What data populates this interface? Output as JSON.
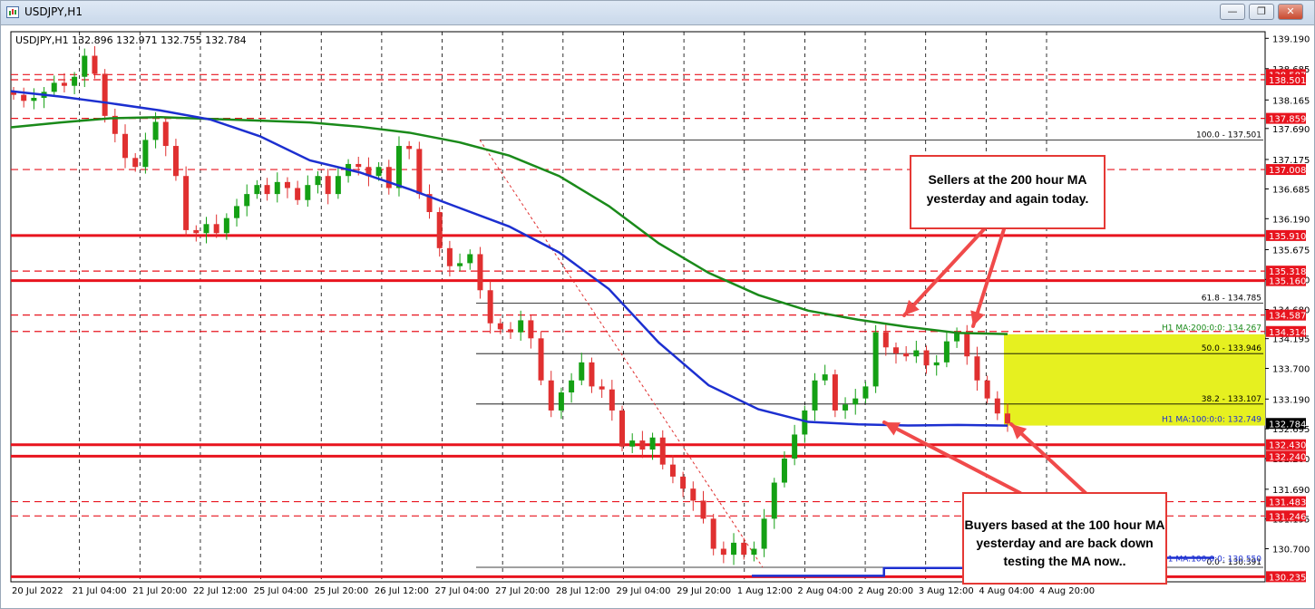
{
  "window": {
    "title": "USDJPY,H1",
    "buttons": [
      "minimize",
      "restore",
      "close"
    ]
  },
  "chart_data": {
    "type": "candlestick",
    "symbol": "USDJPY",
    "timeframe": "H1",
    "info_line": "USDJPY,H1  132.896 132.971 132.755 132.784",
    "current_price": "132.784",
    "ylim": [
      130.15,
      139.3
    ],
    "y_ticks": [
      "139.190",
      "138.685",
      "138.165",
      "137.690",
      "137.175",
      "136.685",
      "136.190",
      "135.675",
      "135.180",
      "134.680",
      "134.195",
      "133.700",
      "133.190",
      "132.695",
      "132.200",
      "131.690",
      "131.195",
      "130.700"
    ],
    "x_ticks": [
      "20 Jul 2022",
      "21 Jul 04:00",
      "21 Jul 20:00",
      "22 Jul 12:00",
      "25 Jul 04:00",
      "25 Jul 20:00",
      "26 Jul 12:00",
      "27 Jul 04:00",
      "27 Jul 20:00",
      "28 Jul 12:00",
      "29 Jul 04:00",
      "29 Jul 20:00",
      "1 Aug 12:00",
      "2 Aug 04:00",
      "2 Aug 20:00",
      "3 Aug 12:00",
      "4 Aug 04:00",
      "4 Aug 20:00"
    ],
    "close_series_approx": [
      138.25,
      138.15,
      138.2,
      138.3,
      138.45,
      138.4,
      138.55,
      138.9,
      138.6,
      137.9,
      137.6,
      137.2,
      137.05,
      137.5,
      137.8,
      137.4,
      136.9,
      136.0,
      135.95,
      136.1,
      135.95,
      136.2,
      136.4,
      136.6,
      136.75,
      136.6,
      136.8,
      136.7,
      136.5,
      136.75,
      136.9,
      136.6,
      136.9,
      137.1,
      137.05,
      136.9,
      137.05,
      136.7,
      137.4,
      137.35,
      136.6,
      136.3,
      135.7,
      135.4,
      135.45,
      135.6,
      135.0,
      134.45,
      134.35,
      134.3,
      134.5,
      134.2,
      133.5,
      133.0,
      133.3,
      133.5,
      133.8,
      133.4,
      133.35,
      133.0,
      132.4,
      132.5,
      132.35,
      132.55,
      132.1,
      131.9,
      131.7,
      131.5,
      131.2,
      130.7,
      130.6,
      130.8,
      130.6,
      130.7,
      131.2,
      131.8,
      132.2,
      132.6,
      133.0,
      133.5,
      133.6,
      133.0,
      133.1,
      133.2,
      133.4,
      134.3,
      134.05,
      133.95,
      133.9,
      134.0,
      133.75,
      133.8,
      134.15,
      134.3,
      133.9,
      133.5,
      133.2,
      132.95,
      132.784
    ],
    "series": [
      {
        "name": "H1 MA:200:0:0",
        "value_label": "134.267",
        "color": "#1a8a1a",
        "values": [
          137.71,
          137.79,
          137.86,
          137.88,
          137.85,
          137.82,
          137.79,
          137.72,
          137.62,
          137.46,
          137.24,
          136.9,
          136.4,
          135.78,
          135.29,
          134.92,
          134.66,
          134.51,
          134.39,
          134.29,
          134.27
        ]
      },
      {
        "name": "H1 MA:100:0:0",
        "value_label": "132.749",
        "color": "#1c2fd0",
        "values": [
          138.31,
          138.22,
          138.11,
          137.99,
          137.84,
          137.56,
          137.16,
          136.96,
          136.68,
          136.37,
          136.06,
          135.63,
          135.02,
          134.13,
          133.42,
          133.02,
          132.81,
          132.77,
          132.75,
          132.76,
          132.749
        ]
      },
      {
        "name": "D1 MA:100:0:0",
        "value_label": "130.550",
        "color": "#1c2fd0",
        "values": [
          130.25,
          130.25,
          130.38,
          130.38,
          130.55,
          130.55,
          130.55
        ]
      }
    ],
    "horizontal_levels": [
      {
        "label": "138.587",
        "value": 138.587,
        "style": "dashed"
      },
      {
        "label": "138.501",
        "value": 138.501,
        "style": "dashed"
      },
      {
        "label": "137.859",
        "value": 137.859,
        "style": "dashed"
      },
      {
        "label": "137.008",
        "value": 137.008,
        "style": "dashed"
      },
      {
        "label": "135.910",
        "value": 135.91,
        "style": "solid"
      },
      {
        "label": "135.318",
        "value": 135.318,
        "style": "dashed"
      },
      {
        "label": "135.160",
        "value": 135.16,
        "style": "solid"
      },
      {
        "label": "134.587",
        "value": 134.587,
        "style": "dashed"
      },
      {
        "label": "134.314",
        "value": 134.314,
        "style": "dashed"
      },
      {
        "label": "132.430",
        "value": 132.43,
        "style": "solid"
      },
      {
        "label": "132.240",
        "value": 132.24,
        "style": "solid"
      },
      {
        "label": "131.483",
        "value": 131.483,
        "style": "dashed"
      },
      {
        "label": "131.246",
        "value": 131.246,
        "style": "dashed"
      },
      {
        "label": "130.235",
        "value": 130.235,
        "style": "solid"
      }
    ],
    "fibonacci": [
      {
        "label": "100.0 - 137.501",
        "value": 137.501
      },
      {
        "label": "61.8 - 134.785",
        "value": 134.785
      },
      {
        "label": "50.0 - 133.946",
        "value": 133.946
      },
      {
        "label": "38.2 - 133.107",
        "value": 133.107
      },
      {
        "label": "0.0 - 130.391",
        "value": 130.391
      }
    ],
    "highlight_zone": {
      "from": 132.749,
      "to": 134.267,
      "color": "#e6f020"
    },
    "annotations": [
      "Sellers at the 200 hour MA yesterday and again today.",
      "Buyers based at the 100 hour MA yesterday and are back down testing the MA now.."
    ],
    "colors": {
      "bull": "#14a014",
      "bear": "#e03030",
      "levels": "#e8141e",
      "fib": "#000000",
      "trend": "#e03030"
    }
  }
}
